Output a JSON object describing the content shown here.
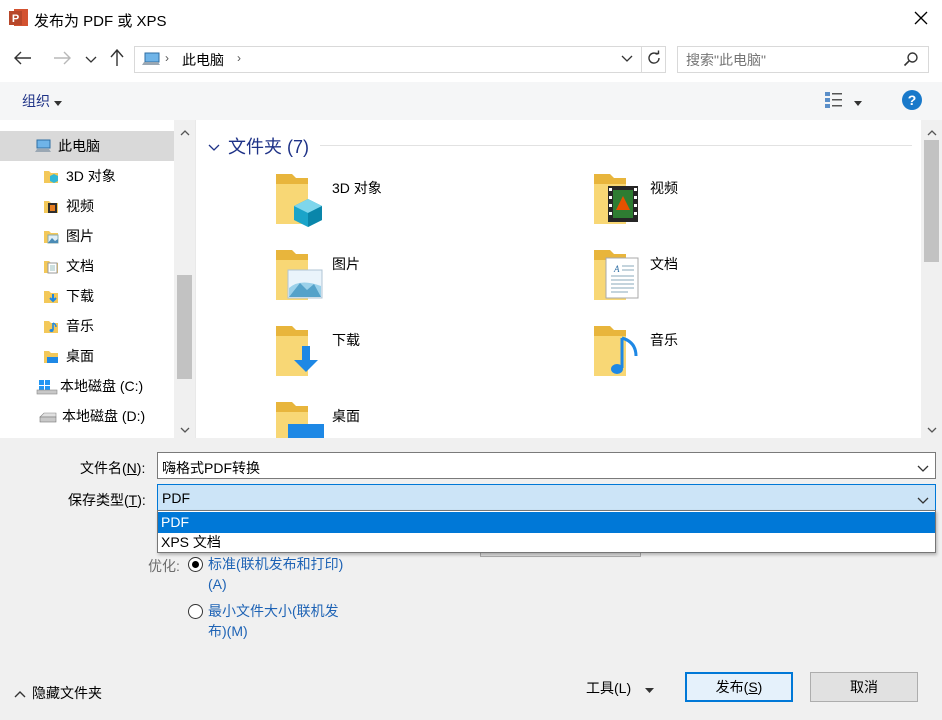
{
  "window": {
    "title": "发布为 PDF 或 XPS",
    "app_icon": "powerpoint-icon",
    "close_icon": "close-icon"
  },
  "navigation": {
    "back_icon": "arrow-left-icon",
    "forward_icon": "arrow-right-icon",
    "recent_icon": "chevron-down-icon",
    "up_icon": "arrow-up-icon",
    "breadcrumb": [
      "此电脑"
    ],
    "refresh_icon": "refresh-icon"
  },
  "search": {
    "placeholder": "搜索\"此电脑\"",
    "icon": "search-icon"
  },
  "toolbar": {
    "organize_label": "组织",
    "view_icon": "view-options-icon",
    "help_label": "?"
  },
  "sidebar": {
    "items": [
      {
        "label": "此电脑",
        "icon": "pc-icon",
        "selected": true
      },
      {
        "label": "3D 对象",
        "icon": "3d-objects-icon"
      },
      {
        "label": "视频",
        "icon": "video-icon"
      },
      {
        "label": "图片",
        "icon": "pictures-icon"
      },
      {
        "label": "文档",
        "icon": "documents-icon"
      },
      {
        "label": "下载",
        "icon": "downloads-icon"
      },
      {
        "label": "音乐",
        "icon": "music-icon"
      },
      {
        "label": "桌面",
        "icon": "desktop-icon"
      },
      {
        "label": "本地磁盘 (C:)",
        "icon": "windows-drive-icon"
      },
      {
        "label": "本地磁盘 (D:)",
        "icon": "drive-icon"
      }
    ]
  },
  "main": {
    "group_title": "文件夹 (7)",
    "folders": [
      {
        "label": "3D 对象",
        "icon": "3d-objects-folder-icon"
      },
      {
        "label": "视频",
        "icon": "video-folder-icon"
      },
      {
        "label": "图片",
        "icon": "pictures-folder-icon"
      },
      {
        "label": "文档",
        "icon": "documents-folder-icon"
      },
      {
        "label": "下载",
        "icon": "downloads-folder-icon"
      },
      {
        "label": "音乐",
        "icon": "music-folder-icon"
      },
      {
        "label": "桌面",
        "icon": "desktop-folder-icon"
      }
    ]
  },
  "form": {
    "filename_label_pre": "文件名(",
    "filename_label_key": "N",
    "filename_label_post": "):",
    "filename_value": "嗨格式PDF转换",
    "filetype_label_pre": "保存类型(",
    "filetype_label_key": "T",
    "filetype_label_post": "):",
    "filetype_value": "PDF",
    "filetype_options": [
      "PDF",
      "XPS 文档"
    ],
    "filetype_highlighted": "PDF"
  },
  "optimize": {
    "label": "优化:",
    "options": [
      {
        "line1": "标准(联机发布和打印)",
        "line2": "(A)",
        "checked": true
      },
      {
        "line1": "最小文件大小(联机发",
        "line2": "布)(M)",
        "checked": false
      }
    ]
  },
  "footer": {
    "hide_folders_label": "隐藏文件夹",
    "tools_label": "工具(L)",
    "publish_label_pre": "发布(",
    "publish_label_key": "S",
    "publish_label_post": ")",
    "cancel_label": "取消"
  },
  "colors": {
    "accent": "#0078d7",
    "link": "#1e3287",
    "radio_text": "#1e63b5"
  }
}
